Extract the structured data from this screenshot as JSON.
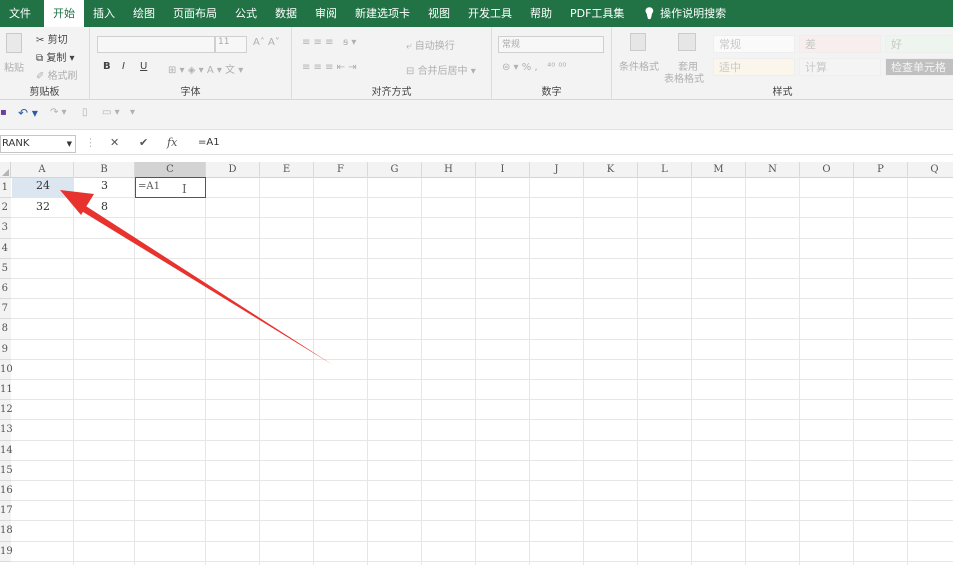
{
  "tabs": [
    "文件",
    "开始",
    "插入",
    "绘图",
    "页面布局",
    "公式",
    "数据",
    "审阅",
    "新建选项卡",
    "视图",
    "开发工具",
    "帮助",
    "PDF工具集",
    "操作说明搜索"
  ],
  "active_tab": "开始",
  "clipboard": {
    "cut": "剪切",
    "copy": "复制",
    "paint": "格式刷",
    "paste": "粘贴",
    "label": "剪贴板"
  },
  "font": {
    "size": "11",
    "bold": "B",
    "italic": "I",
    "underline": "U",
    "label": "字体"
  },
  "align": {
    "wrap": "自动换行",
    "merge": "合并后居中",
    "label": "对齐方式"
  },
  "number": {
    "format": "常规",
    "percent": "%",
    "comma": ",",
    "label": "数字"
  },
  "styles": {
    "cond": "条件格式",
    "table1": "套用",
    "table2": "表格格式",
    "normal": "常规",
    "bad": "差",
    "good": "好",
    "neutral": "适中",
    "calc": "计算",
    "check": "检查单元格",
    "label": "样式"
  },
  "namebox": "RANK",
  "formula_text": "=A1",
  "columns": [
    "A",
    "B",
    "C",
    "D",
    "E",
    "F",
    "G",
    "H",
    "I",
    "J",
    "K",
    "L",
    "M",
    "N",
    "O",
    "P",
    "Q"
  ],
  "rows": [
    "1",
    "2",
    "3",
    "4",
    "5",
    "6",
    "7",
    "8",
    "9",
    "10",
    "11",
    "12",
    "13",
    "14",
    "15",
    "16",
    "17",
    "18",
    "19"
  ],
  "cells": {
    "A1": "24",
    "B1": "3",
    "C1": "=A1",
    "A2": "32",
    "B2": "8"
  },
  "colors": {
    "accent": "#217346",
    "arrow": "#e8322e",
    "selected": "#dce6f1"
  }
}
